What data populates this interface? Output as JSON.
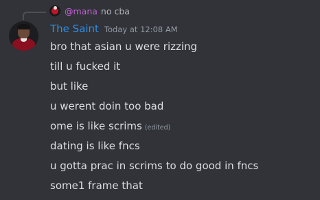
{
  "reply": {
    "username": "@mana",
    "text": "no cba"
  },
  "message": {
    "author": "The Saint",
    "timestamp": "Today at 12:08 AM",
    "lines": [
      "bro that asian u were rizzing",
      "till u fucked it",
      "but like",
      "u werent doin too bad",
      "ome is like scrims",
      "dating is like fncs",
      "u gotta prac in scrims to do good in fncs",
      "some1 frame that"
    ],
    "edited_label": "(edited)"
  },
  "colors": {
    "background": "#313338",
    "author": "#2e8fe6",
    "reply_author": "#c45fd6",
    "text": "#dbdee1",
    "muted": "#949ba4"
  }
}
